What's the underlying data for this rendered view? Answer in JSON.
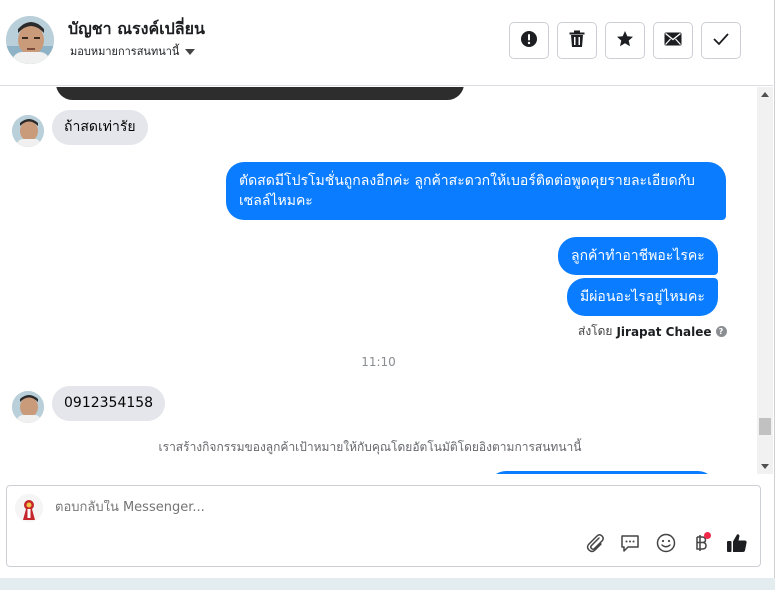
{
  "header": {
    "contact_name": "บัญชา ณรงค์เปลี่ยน",
    "assign_label": "มอบหมายการสนทนานี้",
    "actions": [
      "alert-icon",
      "trash-icon",
      "star-icon",
      "mail-icon",
      "check-icon"
    ]
  },
  "thread": {
    "messages": {
      "in1": "ถ้าสดเท่ารัย",
      "out1": "ตัดสดมีโปรโมชั่นถูกลงอีกค่ะ ลูกค้าสะดวกให้เบอร์ติดต่อพูดคุยรายละเอียดกับเซลล์ไหมคะ",
      "out2": "ลูกค้าทำอาชีพอะไรคะ",
      "out3": "มีผ่อนอะไรอยู่ไหมคะ",
      "in2": "0912354158"
    },
    "sent_by_prefix": "ส่งโดย",
    "sent_by_name": "Jirapat Chalee",
    "time_divider": "11:10",
    "system_note": "เราสร้างกิจกรรมของลูกค้าเป้าหมายให้กับคุณโดยอัตโนมัติโดยอิงตามการสนทนานี้"
  },
  "composer": {
    "placeholder": "ตอบกลับใน Messenger...",
    "tools": [
      "paperclip-icon",
      "saved-reply-icon",
      "emoji-icon",
      "baht-icon",
      "thumbs-up-icon"
    ],
    "accent": "#0a7cff"
  }
}
